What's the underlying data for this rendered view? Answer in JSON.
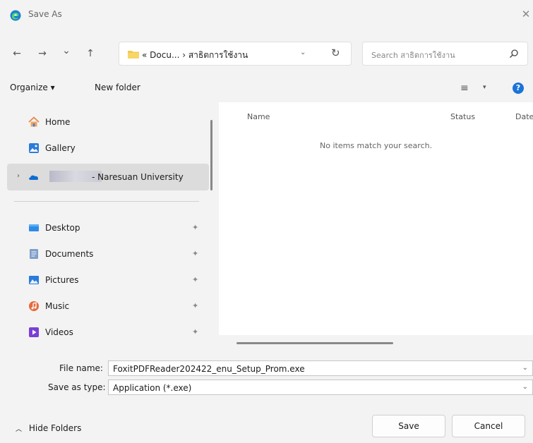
{
  "window": {
    "title": "Save As",
    "close": "✕"
  },
  "nav": {
    "back": "←",
    "forward": "→",
    "recent": "⌄",
    "up": "↑",
    "address_path": "« Docu... › สาธิตการใช้งาน",
    "address_dropdown": "⌄",
    "refresh": "↻",
    "search_placeholder": "Search สาธิตการใช้งาน"
  },
  "toolbar": {
    "organize": "Organize ▾",
    "new_folder": "New folder",
    "view": "≡",
    "view_dropdown": "▾",
    "help": "?"
  },
  "sidebar": {
    "home": "Home",
    "gallery": "Gallery",
    "onedrive": "- Naresuan University",
    "desktop": "Desktop",
    "documents": "Documents",
    "pictures": "Pictures",
    "music": "Music",
    "videos": "Videos"
  },
  "main": {
    "columns": [
      "Name",
      "Status",
      "Date"
    ],
    "empty_message": "No items match your search."
  },
  "form": {
    "file_name_label": "File name:",
    "file_name_value": "FoxitPDFReader202422_enu_Setup_Prom.exe",
    "save_type_label": "Save as type:",
    "save_type_value": "Application (*.exe)"
  },
  "footer": {
    "hide_folders": "Hide Folders",
    "save": "Save",
    "cancel": "Cancel"
  },
  "colors": {
    "accent": "#1a73d9",
    "folder": "#f2c94c",
    "background": "#f3f3f3"
  }
}
